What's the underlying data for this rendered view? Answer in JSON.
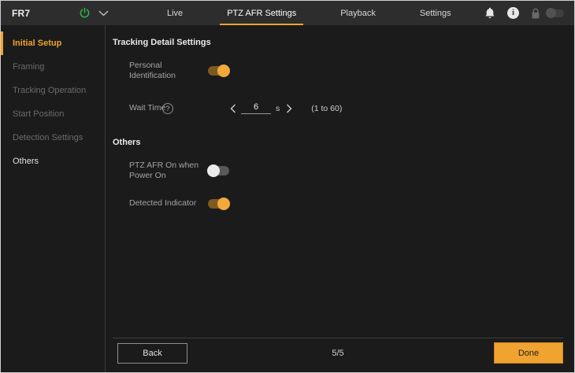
{
  "accent_color": "#F0A330",
  "power_color": "#2FAE43",
  "header": {
    "device_name": "FR7",
    "tabs": {
      "live": "Live",
      "ptz_afr": "PTZ AFR Settings",
      "playback": "Playback",
      "settings": "Settings"
    },
    "icons": {
      "power": "power-icon",
      "chevron": "chevron-down-icon",
      "bell": "bell-icon",
      "info": "info-icon",
      "info_glyph": "i",
      "lock": "lock-icon"
    }
  },
  "sidebar": {
    "items": [
      {
        "label": "Initial Setup",
        "state": "active"
      },
      {
        "label": "Framing",
        "state": "disabled"
      },
      {
        "label": "Tracking Operation",
        "state": "disabled"
      },
      {
        "label": "Start Position",
        "state": "disabled"
      },
      {
        "label": "Detection Settings",
        "state": "disabled"
      },
      {
        "label": "Others",
        "state": "normal"
      }
    ]
  },
  "main": {
    "section1": {
      "title": "Tracking Detail Settings",
      "personal_identification": {
        "label": "Personal Identification",
        "value": "on"
      },
      "wait_time": {
        "label": "Wait Time",
        "help_glyph": "?",
        "value": "6",
        "unit": "s",
        "range": "(1 to 60)"
      }
    },
    "section2": {
      "title": "Others",
      "ptz_afr_power": {
        "label": "PTZ AFR On when Power On",
        "value": "off"
      },
      "detected_indicator": {
        "label": "Detected Indicator",
        "value": "on"
      }
    }
  },
  "footer": {
    "back": "Back",
    "page": "5/5",
    "done": "Done"
  }
}
